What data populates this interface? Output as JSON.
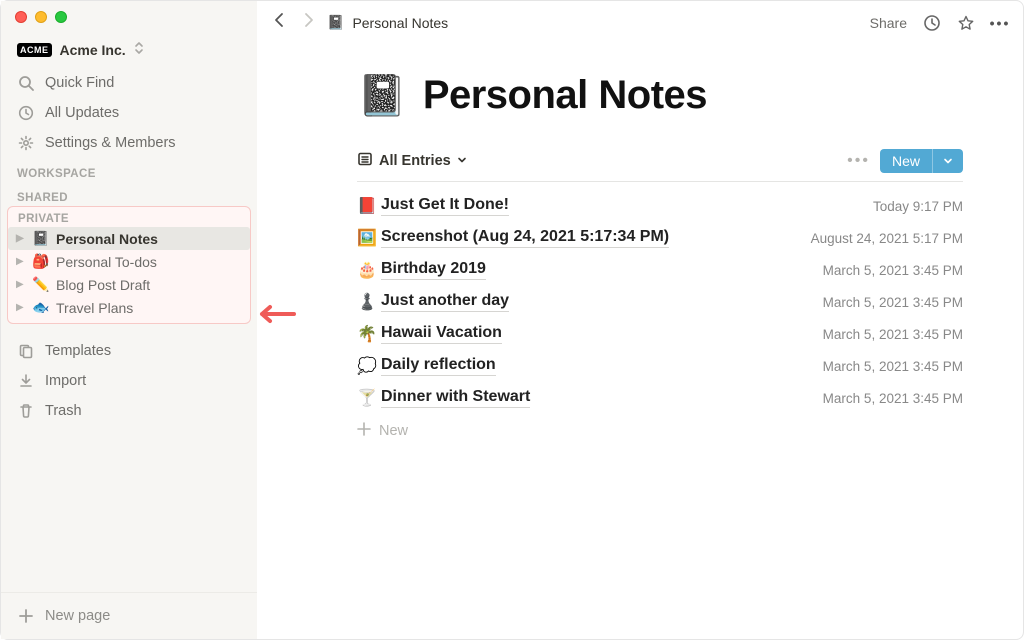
{
  "workspace": {
    "name": "Acme Inc.",
    "badge": "ACME"
  },
  "sidebar": {
    "quick_find": "Quick Find",
    "all_updates": "All Updates",
    "settings": "Settings & Members",
    "sections": {
      "workspace": "WORKSPACE",
      "shared": "SHARED",
      "private": "PRIVATE"
    },
    "private_pages": [
      {
        "icon": "📓",
        "label": "Personal Notes"
      },
      {
        "icon": "🎒",
        "label": "Personal To-dos"
      },
      {
        "icon": "✏️",
        "label": "Blog Post Draft"
      },
      {
        "icon": "🐟",
        "label": "Travel Plans"
      }
    ],
    "templates": "Templates",
    "import": "Import",
    "trash": "Trash",
    "new_page": "New page"
  },
  "topbar": {
    "breadcrumb_icon": "📓",
    "breadcrumb": "Personal Notes",
    "share": "Share"
  },
  "page": {
    "icon": "📓",
    "title": "Personal Notes",
    "view_name": "All Entries",
    "new_button": "New",
    "new_entry": "New",
    "entries": [
      {
        "icon": "📕",
        "title": "Just Get It Done!",
        "time": "Today 9:17 PM"
      },
      {
        "icon": "🖼️",
        "title": "Screenshot (Aug 24, 2021 5:17:34 PM)",
        "time": "August 24, 2021 5:17 PM"
      },
      {
        "icon": "🎂",
        "title": "Birthday 2019",
        "time": "March 5, 2021 3:45 PM"
      },
      {
        "icon": "♟️",
        "title": "Just another day",
        "time": "March 5, 2021 3:45 PM"
      },
      {
        "icon": "🌴",
        "title": "Hawaii Vacation",
        "time": "March 5, 2021 3:45 PM"
      },
      {
        "icon": "💭",
        "title": "Daily reflection",
        "time": "March 5, 2021 3:45 PM"
      },
      {
        "icon": "🍸",
        "title": "Dinner with Stewart",
        "time": "March 5, 2021 3:45 PM"
      }
    ]
  }
}
